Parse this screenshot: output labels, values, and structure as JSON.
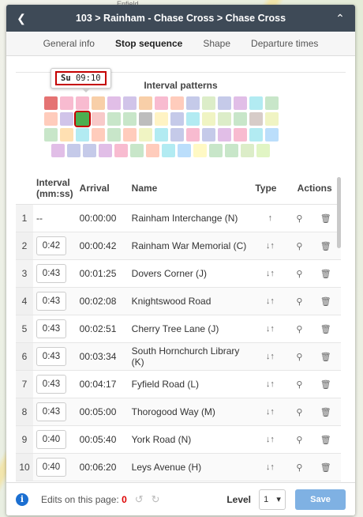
{
  "map": {
    "labels": [
      "Enfield"
    ]
  },
  "header": {
    "title": "103 > Rainham - Chase Cross > Chase Cross",
    "back_icon": "chevron-left-icon",
    "collapse_icon": "chevron-up-icon"
  },
  "tabs": [
    {
      "label": "General info",
      "active": false
    },
    {
      "label": "Stop sequence",
      "active": true
    },
    {
      "label": "Shape",
      "active": false
    },
    {
      "label": "Departure times",
      "active": false
    }
  ],
  "patterns": {
    "title": "Interval patterns",
    "tooltip": {
      "day": "Su",
      "time": "09:10"
    },
    "rows": [
      [
        "#e57373",
        "#f8bbd0",
        "#f8bbd0",
        "#f8cfa8",
        "#e1bee7",
        "#d1c4e9",
        "#f8cfa8",
        "#f8bbd0",
        "#ffccbc",
        "#c5cae9",
        "#dcedc8",
        "#c5cae9",
        "#e1bee7",
        "#b2ebf2",
        "#c8e6c9"
      ],
      [
        "#ffccbc",
        "#d1c4e9",
        "#4caf50",
        "#f8c9c9",
        "#c8e6c9",
        "#c8e6c9",
        "#bdbdbd",
        "#fff3c4",
        "#c5cae9",
        "#b2ebf2",
        "#f0f4c3",
        "#dcedc8",
        "#c8e6c9",
        "#d7ccc8",
        "#f0f4c3"
      ],
      [
        "#c8e6c9",
        "#ffe0b2",
        "#b2ebf2",
        "#ffccbc",
        "#c8e6c9",
        "#ffccbc",
        "#f0f4c3",
        "#b2ebf2",
        "#c5cae9",
        "#f8bbd0",
        "#c5cae9",
        "#e1bee7",
        "#f8bbd0",
        "#b2ebf2",
        "#bbdefb"
      ],
      [
        "#e1bee7",
        "#c5cae9",
        "#c5cae9",
        "#e1bee7",
        "#f8bbd0",
        "#c8e6c9",
        "#ffccbc",
        "#b2ebf2",
        "#bbdefb",
        "#fff9c4",
        "#c8e6c9",
        "#c8e6c9",
        "#dcedc8",
        "#e1f5c4"
      ]
    ],
    "selected": {
      "row": 1,
      "col": 2
    }
  },
  "table": {
    "headers": [
      "Interval (mm:ss)",
      "Arrival",
      "Name",
      "Type",
      "Actions"
    ],
    "rows": [
      {
        "n": "1",
        "interval": "--",
        "arrival": "00:00:00",
        "name": "Rainham Interchange (N)",
        "type": "↑"
      },
      {
        "n": "2",
        "interval": "0:42",
        "arrival": "00:00:42",
        "name": "Rainham War Memorial (C)",
        "type": "↓↑"
      },
      {
        "n": "3",
        "interval": "0:43",
        "arrival": "00:01:25",
        "name": "Dovers Corner (J)",
        "type": "↓↑"
      },
      {
        "n": "4",
        "interval": "0:43",
        "arrival": "00:02:08",
        "name": "Knightswood Road",
        "type": "↓↑"
      },
      {
        "n": "5",
        "interval": "0:43",
        "arrival": "00:02:51",
        "name": "Cherry Tree Lane (J)",
        "type": "↓↑"
      },
      {
        "n": "6",
        "interval": "0:43",
        "arrival": "00:03:34",
        "name": "South Hornchurch Library (K)",
        "type": "↓↑"
      },
      {
        "n": "7",
        "interval": "0:43",
        "arrival": "00:04:17",
        "name": "Fyfield Road (L)",
        "type": "↓↑"
      },
      {
        "n": "8",
        "interval": "0:43",
        "arrival": "00:05:00",
        "name": "Thorogood Way (M)",
        "type": "↓↑"
      },
      {
        "n": "9",
        "interval": "0:40",
        "arrival": "00:05:40",
        "name": "York Road (N)",
        "type": "↓↑"
      },
      {
        "n": "10",
        "interval": "0:40",
        "arrival": "00:06:20",
        "name": "Leys Avenue (H)",
        "type": "↓↑"
      }
    ]
  },
  "footer": {
    "edits_label": "Edits on this page:",
    "edits_count": "0",
    "level_label": "Level",
    "level_value": "1",
    "save_label": "Save"
  }
}
